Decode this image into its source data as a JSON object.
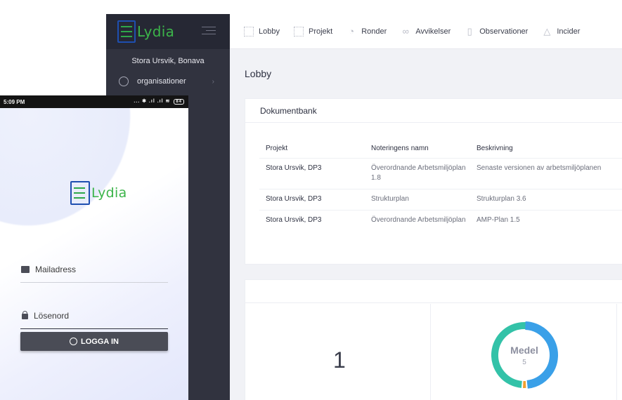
{
  "desktop": {
    "logo_text": "Lydia",
    "org_line": "Stora Ursvik, Bonava",
    "sidebar": {
      "items": [
        {
          "label": "organisationer"
        }
      ]
    },
    "nav": [
      {
        "label": "Lobby",
        "icon": "grid-icon"
      },
      {
        "label": "Projekt",
        "icon": "project-icon"
      },
      {
        "label": "Ronder",
        "icon": "timer-icon"
      },
      {
        "label": "Avvikelser",
        "icon": "infinity-icon"
      },
      {
        "label": "Observationer",
        "icon": "document-icon"
      },
      {
        "label": "Incider",
        "icon": "warning-icon"
      }
    ],
    "page_title": "Lobby",
    "document_bank": {
      "title": "Dokumentbank",
      "columns": [
        "Projekt",
        "Noteringens namn",
        "Beskrivning"
      ],
      "rows": [
        [
          "Stora Ursvik, DP3",
          "Överordnande Arbetsmiljöplan 1.8",
          "Senaste versionen av arbetsmiljöplanen"
        ],
        [
          "Stora Ursvik, DP3",
          "Strukturplan",
          "Strukturplan 3.6"
        ],
        [
          "Stora Ursvik, DP3",
          "Överordnande Arbetsmiljöplan",
          "AMP-Plan 1.5"
        ]
      ]
    },
    "stats": {
      "count": "1",
      "donut": {
        "label": "Medel",
        "value": "5",
        "colors": [
          "#3aa0e8",
          "#33c2a8",
          "#f0a030"
        ]
      }
    }
  },
  "phone": {
    "status_time": "5:09 PM",
    "status_icons": "... ✱ .ıl .ıl ≋",
    "battery": "84",
    "logo_text": "Lydia",
    "email_placeholder": "Mailadress",
    "password_placeholder": "Lösenord",
    "login_label": "LOGGA IN"
  }
}
